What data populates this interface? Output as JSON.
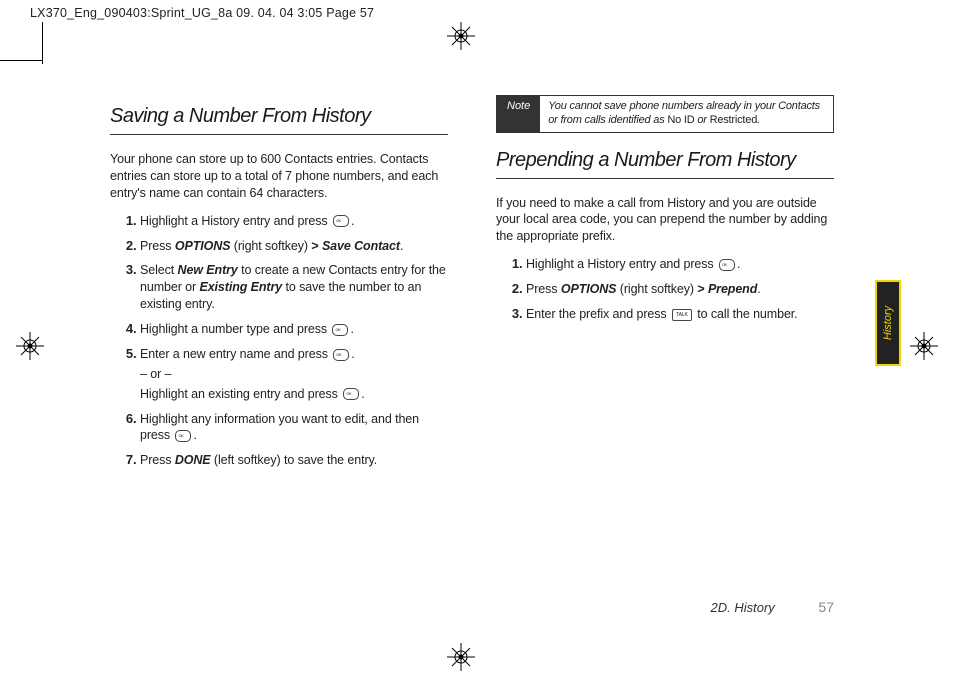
{
  "header": "LX370_Eng_090403:Sprint_UG_8a  09. 04. 04      3:05  Page 57",
  "left": {
    "heading": "Saving a Number From History",
    "intro": "Your phone can store up to 600 Contacts entries. Contacts entries can store up to a total of 7 phone numbers, and each entry's name can contain 64 characters.",
    "steps": {
      "s1": "Highlight a History entry and press ",
      "s1b": ".",
      "s2a": "Press ",
      "s2b": "OPTIONS",
      "s2c": " (right softkey) ",
      "s2d": ">",
      "s2e": " ",
      "s2f": "Save Contact",
      "s2g": ".",
      "s3a": "Select ",
      "s3b": "New Entry",
      "s3c": " to create a new Contacts entry for the number or ",
      "s3d": "Existing Entry",
      "s3e": " to save the number to an existing entry.",
      "s4a": "Highlight a number type and press ",
      "s4b": ".",
      "s5a": "Enter a new entry name and press ",
      "s5b": ".",
      "s5or": "– or –",
      "s5c": "Highlight an existing entry and press ",
      "s5d": ".",
      "s6a": "Highlight any information you want to edit, and then press ",
      "s6b": ".",
      "s7a": "Press ",
      "s7b": "DONE",
      "s7c": " (left softkey) to save the entry."
    }
  },
  "note": {
    "label": "Note",
    "text_a": "You cannot save phone numbers already in your Contacts or from calls identified as ",
    "text_b": "No ID",
    "text_c": " or ",
    "text_d": "Restricted",
    "text_e": "."
  },
  "right": {
    "heading": "Prepending a Number From History",
    "intro": "If you need to make a call from History and you are outside your local area code, you can prepend the number by adding the appropriate prefix.",
    "steps": {
      "s1a": "Highlight a History entry and press ",
      "s1b": ".",
      "s2a": "Press ",
      "s2b": "OPTIONS",
      "s2c": " (right softkey) ",
      "s2d": ">",
      "s2e": " ",
      "s2f": "Prepend",
      "s2g": ".",
      "s3a": "Enter the prefix and press ",
      "s3b": " to call the number."
    }
  },
  "tab": "History",
  "footer": {
    "section": "2D. History",
    "page": "57"
  }
}
